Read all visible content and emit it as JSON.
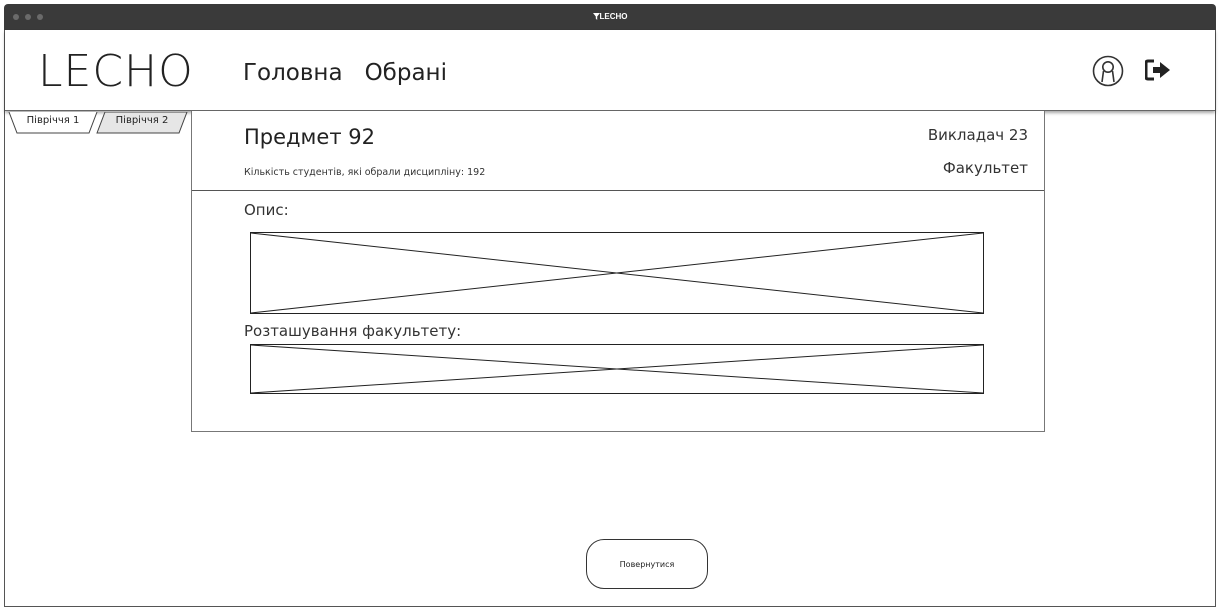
{
  "window": {
    "title": "LECHO"
  },
  "header": {
    "brand": "LECHO",
    "nav": {
      "home": "Головна",
      "favorites": "Обрані"
    }
  },
  "tabs": [
    "Півріччя 1",
    "Півріччя 2"
  ],
  "course": {
    "subject": "Предмет 92",
    "students_label": "Кількість студентів,  які обрали дисципліну: 192",
    "teacher": "Викладач 23",
    "faculty": "Факультет",
    "description_label": "Опис:",
    "location_label": "Розташування факультету:"
  },
  "actions": {
    "back": "Повернутися"
  },
  "icons": [
    "user-icon",
    "logout-icon",
    "funnel-icon",
    "image-placeholder-icon"
  ]
}
